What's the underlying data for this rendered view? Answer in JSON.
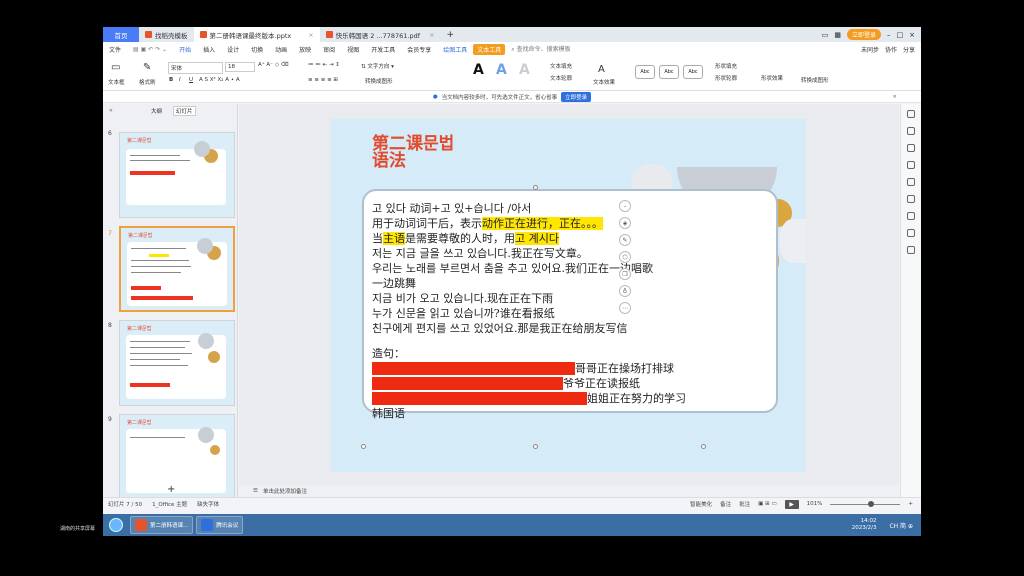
{
  "tabs": [
    {
      "label": "首页",
      "type": "home"
    },
    {
      "label": "找稻壳模板",
      "color": "#e8542a"
    },
    {
      "label": "第二册韩语课最终版本.pptx",
      "color": "#e8542a",
      "active": true
    },
    {
      "label": "快乐韩国语 2 ...778761.pdf",
      "color": "#e8542a"
    }
  ],
  "tab_add": "+",
  "login_label": "立即登录",
  "menus": [
    "文件",
    "开始",
    "插入",
    "设计",
    "切换",
    "动画",
    "放映",
    "审阅",
    "视图",
    "开发工具",
    "会员专享"
  ],
  "menu_drawing_tools": "绘图工具",
  "menu_text_tools": "文本工具",
  "search_placeholder": "查找命令、搜索模板",
  "menu_right": [
    "未同步",
    "协作",
    "分享"
  ],
  "ribbon": {
    "textbox": "文本框",
    "format_painter": "格式刷",
    "font_name": "宋体",
    "font_size": "18",
    "convert_graphics": "转换成图形",
    "text_fill": "文本填充",
    "text_outline": "文本轮廓",
    "text_effects": "文本效果",
    "shape_fill": "形状填充",
    "shape_outline": "形状轮廓",
    "shape_effects": "形状效果",
    "abc": "Abc",
    "big_a": "A"
  },
  "notice": {
    "text": "当文档内容较多时，可先选文件正文，省心省事",
    "button": "立即登录"
  },
  "leftpane": {
    "tab_outline": "大纲",
    "tab_slides": "幻灯片",
    "slide_numbers": [
      "6",
      "7",
      "8",
      "9"
    ],
    "add_icon": "+"
  },
  "slide": {
    "title_line1": "第二课문법",
    "title_line2": "语法",
    "lines": [
      "고 있다 动词+고 있+습니다 /아서",
      "用于动词词干后，表示动作正在进行，正在。。。",
      "当主语是需要尊敬的人时，用고 계시다",
      "저는 지금 글을 쓰고 있습니다.我正在写文章。",
      "우리는 노래를 부르면서 춤을 추고 있어요.我们正在一边唱歌",
      "一边跳舞",
      "지금 비가 오고 있습니다.现在正在下雨",
      "누가 신문을 읽고 있습니까?谁在看报纸",
      "친구에게 편지를 쓰고 있었어요.那是我正在给朋友写信",
      "",
      "造句：",
      "哥哥正在操场打排球",
      "爷爷正在读报纸",
      "姐姐正在努力的学习",
      "韩国语"
    ]
  },
  "notes_placeholder": "单击此处添加备注",
  "status": {
    "slide_count": "幻灯片 7 / 50",
    "theme": "1_Office 主题",
    "missing_fonts": "缺失字体",
    "smart_beautify": "智能美化",
    "notes": "备注",
    "comments": "批注",
    "zoom": "101%"
  },
  "taskbar": {
    "items": [
      "第二册韩语课...",
      "腾讯会议"
    ],
    "clock_time": "14:02",
    "clock_date": "2023/2/3",
    "tray_lang": "CH 简 ⊕"
  },
  "footer_label": "湖南的共享屏幕",
  "colors": {
    "accent": "#4a7cf7",
    "title_red": "#e34b2e",
    "highlight": "#ffe600",
    "redact": "#ee2a10",
    "taskbar": "#3a6ea5"
  }
}
